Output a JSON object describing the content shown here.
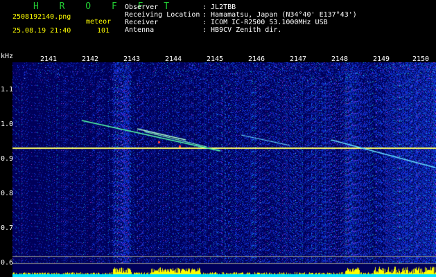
{
  "header": {
    "title": "H R O F F T",
    "filename": "2508192140.png",
    "event_type": "meteor",
    "datetime": "25.08.19 21:40",
    "count": "101",
    "labels": [
      "Observer",
      "Receiving Location",
      "Receiver",
      "Antenna"
    ],
    "values": [
      ": JL2TBB",
      ": Hamamatsu, Japan (N34°40' E137°43')",
      ": ICOM IC-R2500 53.1000MHz USB",
      ": HB9CV Zenith dir."
    ]
  },
  "chart_data": {
    "type": "heatmap",
    "y_unit": "kHz",
    "y_ticks": [
      "1.1",
      "1.0",
      "0.9",
      "0.8",
      "0.7",
      "0.6"
    ],
    "x_ticks": [
      "2141",
      "2142",
      "2143",
      "2144",
      "2145",
      "2146",
      "2147",
      "2148",
      "2149",
      "2150"
    ],
    "carrier_khz": 0.93,
    "colors": {
      "background": "#00005a",
      "noise": "#2a4cff",
      "carrier": "#ffff66",
      "signal": "#55ffaa",
      "spectrum": "#ffff00",
      "baseline": "#00e0ff"
    }
  }
}
